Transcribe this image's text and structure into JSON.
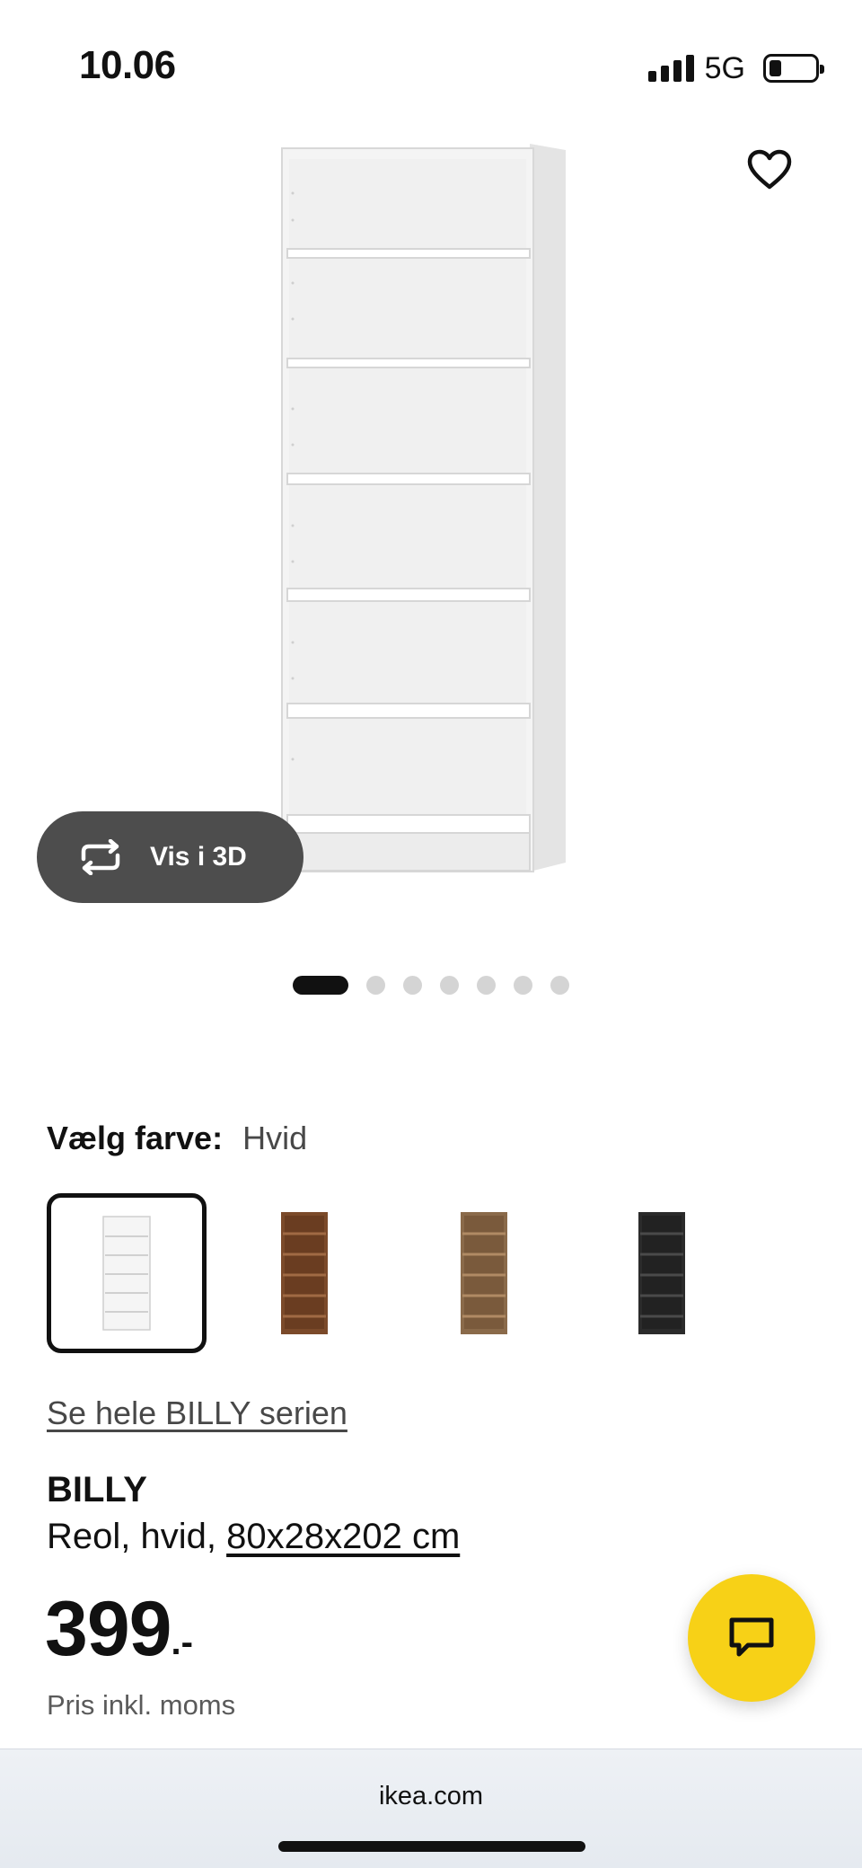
{
  "status_bar": {
    "time": "10.06",
    "network": "5G",
    "battery_level": 0.25,
    "signal_bars": 4
  },
  "product_image": {
    "alt": "BILLY"
  },
  "view_3d": {
    "label": "Vis i 3D",
    "icon": "rotate-3d-icon"
  },
  "carousel": {
    "count": 7,
    "active_index": 0
  },
  "color_select": {
    "label": "Vælg farve:",
    "value": "Hvid",
    "options": [
      {
        "name": "white",
        "color": "#f3f3f3",
        "selected": true
      },
      {
        "name": "brown-walnut",
        "color": "#7b4a2a",
        "selected": false
      },
      {
        "name": "oak-effect",
        "color": "#8a6a4a",
        "selected": false
      },
      {
        "name": "black-brown",
        "color": "#2b2b2b",
        "selected": false
      }
    ]
  },
  "series_link": "Se hele BILLY serien",
  "product": {
    "name": "BILLY",
    "description_prefix": "Reol, hvid, ",
    "dimensions": "80x28x202 cm"
  },
  "price": {
    "amount": "399",
    "suffix": ".-",
    "note": "Pris inkl. moms"
  },
  "browser": {
    "url": "ikea.com"
  },
  "colors": {
    "chat_button": "#f7d117",
    "vis3d_button": "#4d4d4d"
  }
}
